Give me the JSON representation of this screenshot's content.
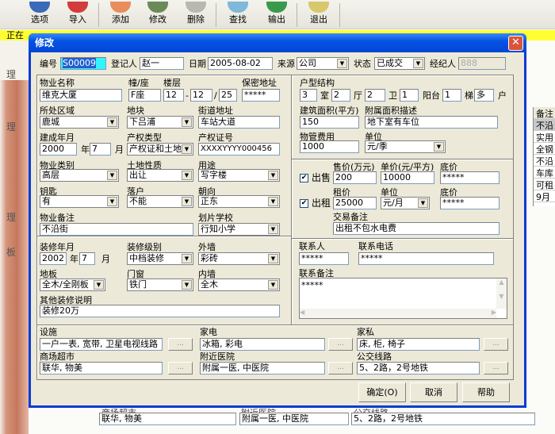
{
  "toolbar": {
    "items": [
      "选项",
      "导入",
      "添加",
      "修改",
      "删除",
      "查找",
      "输出",
      "退出"
    ]
  },
  "statusbar": {
    "text": "正在"
  },
  "left_panel": {
    "items": [
      "理",
      "理",
      "理",
      "板"
    ]
  },
  "bg_table": {
    "header": "备注",
    "rows": [
      "不沿",
      "实用",
      "全钢",
      "不沿",
      "车库",
      "可租",
      "9月"
    ]
  },
  "bg_bottom": {
    "labels": [
      "商场超市",
      "附近医院",
      "公交线路"
    ],
    "values": [
      "联华, 物美",
      "附属一医, 中医院",
      "5、2路，2号地铁"
    ]
  },
  "dialog": {
    "title": "修改",
    "header": {
      "id_label": "编号",
      "id": "S00009",
      "registrar_label": "登记人",
      "registrar": "赵一",
      "date_label": "日期",
      "date": "2005-08-02",
      "source_label": "来源",
      "source": "公司",
      "status_label": "状态",
      "status": "已成交",
      "agent_label": "经纪人",
      "agent": "888"
    },
    "property": {
      "name_label": "物业名称",
      "name": "维克大厦",
      "building_label": "幢/座",
      "building": "F座",
      "floor_label": "楼层",
      "floor_from": "12",
      "floor_sep": "-",
      "floor_to": "12",
      "floor_slash": "/",
      "floor_total": "25",
      "secret_addr_label": "保密地址",
      "secret_addr": "*****",
      "area_label": "所处区域",
      "area": "鹿城",
      "block_label": "地块",
      "block": "下吕浦",
      "street_label": "街道地址",
      "street": "车站大道",
      "built_label": "建成年月",
      "built_year": "2000",
      "year_unit": "年",
      "built_month": "7",
      "month_unit": "月",
      "title_type_label": "产权类型",
      "title_type": "产权证和土地证",
      "title_no_label": "产权证号",
      "title_no": "XXXXYYYY000456",
      "category_label": "物业类别",
      "category": "高层",
      "land_label": "土地性质",
      "land": "出让",
      "use_label": "用途",
      "use": "写字楼",
      "key_label": "钥匙",
      "key": "有",
      "hukou_label": "落户",
      "hukou": "不能",
      "facing_label": "朝向",
      "facing": "正东",
      "note_label": "物业备注",
      "note": "不沿街",
      "school_label": "划片学校",
      "school": "行知小学"
    },
    "layout": {
      "label": "户型结构",
      "rooms": "3",
      "rooms_unit": "室",
      "halls": "2",
      "halls_unit": "厅",
      "baths": "2",
      "baths_unit": "卫",
      "balcony": "1",
      "balcony_unit": "阳台",
      "stairs": "1",
      "stairs_unit": "梯",
      "households": "多",
      "households_unit": "户",
      "area_label": "建筑面积(平方)",
      "area": "150",
      "extra_label": "附属面积描述",
      "extra": "地下室有车位",
      "fee_label": "物管费用",
      "fee": "1000",
      "fee_unit_label": "单位",
      "fee_unit": "元/季"
    },
    "trade": {
      "sale_label": "出售",
      "sale_checked": true,
      "sale_price_label": "售价(万元)",
      "sale_price": "200",
      "unit_price_label": "单价(元/平方)",
      "unit_price": "10000",
      "floor_price_label": "底价",
      "sale_floor": "*****",
      "rent_label": "出租",
      "rent_checked": true,
      "rent_price_label": "租价",
      "rent_price": "25000",
      "rent_unit_label": "单位",
      "rent_unit": "元/月",
      "rent_floor_label": "底价",
      "rent_floor": "*****",
      "note_label": "交易备注",
      "note": "出租不包水电费"
    },
    "decoration": {
      "date_label": "装修年月",
      "year": "2002",
      "year_unit": "年",
      "month": "7",
      "month_unit": "月",
      "level_label": "装修级别",
      "level": "中档装修",
      "outer_label": "外墙",
      "outer": "彩砖",
      "floor_label": "地板",
      "floor": "全木/全刚板",
      "window_label": "门窗",
      "window": "铁门",
      "inner_label": "内墙",
      "inner": "全木",
      "other_label": "其他装修说明",
      "other": "装修20万"
    },
    "contact": {
      "person_label": "联系人",
      "person": "*****",
      "phone_label": "联系电话",
      "phone": "*****",
      "note_label": "联系备注",
      "note": "*****"
    },
    "amenities": {
      "facilities_label": "设施",
      "facilities": "一户一表, 宽带, 卫星电视线路",
      "appliances_label": "家电",
      "appliances": "冰箱, 彩电",
      "furniture_label": "家私",
      "furniture": "床, 柜, 椅子",
      "mall_label": "商场超市",
      "mall": "联华, 物美",
      "hospital_label": "附近医院",
      "hospital": "附属一医, 中医院",
      "bus_label": "公交线路",
      "bus": "5、2路，2号地铁",
      "more": "..."
    },
    "buttons": {
      "ok": "确定(O)",
      "cancel": "取消",
      "help": "帮助"
    }
  }
}
